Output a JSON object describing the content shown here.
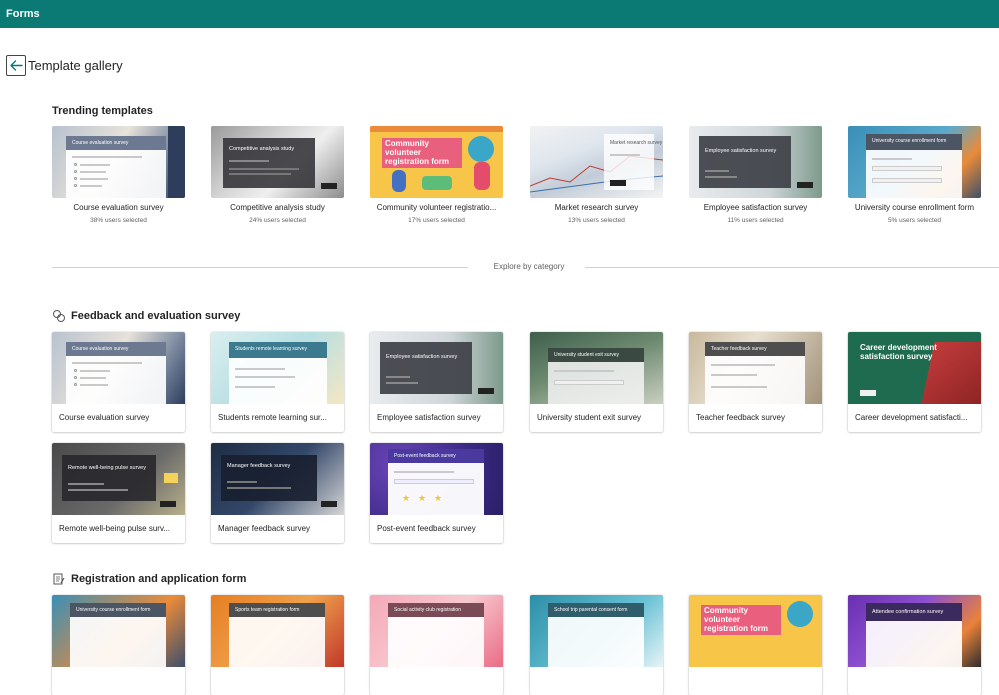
{
  "app": {
    "name": "Forms"
  },
  "header": {
    "title": "Template gallery"
  },
  "trending": {
    "heading": "Trending templates",
    "items": [
      {
        "name": "Course evaluation survey",
        "pct": "38% users selected",
        "thumb_title": "Course evaluation survey"
      },
      {
        "name": "Competitive analysis study",
        "pct": "24% users selected",
        "thumb_title": "Competitive analysis study"
      },
      {
        "name": "Community volunteer registratio...",
        "pct": "17% users selected",
        "thumb_title": "Community volunteer registration form"
      },
      {
        "name": "Market research survey",
        "pct": "13% users selected",
        "thumb_title": "Market research survey"
      },
      {
        "name": "Employee satisfaction survey",
        "pct": "11% users selected",
        "thumb_title": "Employee satisfaction survey"
      },
      {
        "name": "University course enrollment form",
        "pct": "5% users selected",
        "thumb_title": "University course enrollment form"
      }
    ]
  },
  "explore": {
    "label": "Explore by category"
  },
  "feedback": {
    "heading": "Feedback and evaluation survey",
    "items": [
      {
        "name": "Course evaluation survey",
        "thumb_title": "Course evaluation survey"
      },
      {
        "name": "Students remote learning sur...",
        "thumb_title": "Students remote learning survey"
      },
      {
        "name": "Employee satisfaction survey",
        "thumb_title": "Employee satisfaction survey"
      },
      {
        "name": "University student exit survey",
        "thumb_title": "University student exit survey"
      },
      {
        "name": "Teacher feedback survey",
        "thumb_title": "Teacher feedback survey"
      },
      {
        "name": "Career development satisfacti...",
        "thumb_title": "Career development satisfaction survey"
      },
      {
        "name": "Remote well-being pulse surv...",
        "thumb_title": "Remote well-being pulse survey"
      },
      {
        "name": "Manager feedback survey",
        "thumb_title": "Manager feedback survey"
      },
      {
        "name": "Post-event feedback survey",
        "thumb_title": "Post-event feedback survey"
      }
    ]
  },
  "registration": {
    "heading": "Registration and application form",
    "items": [
      {
        "thumb_title": "University course enrollment form"
      },
      {
        "thumb_title": "Sports team registration form"
      },
      {
        "thumb_title": "Social activity club registration"
      },
      {
        "thumb_title": "School trip parental consent form"
      },
      {
        "thumb_title": "Community volunteer registration form"
      },
      {
        "thumb_title": "Attendee confirmation survey"
      }
    ]
  },
  "colors": {
    "topbar": "#0b7a75",
    "text": "#242424",
    "muted": "#616161"
  }
}
